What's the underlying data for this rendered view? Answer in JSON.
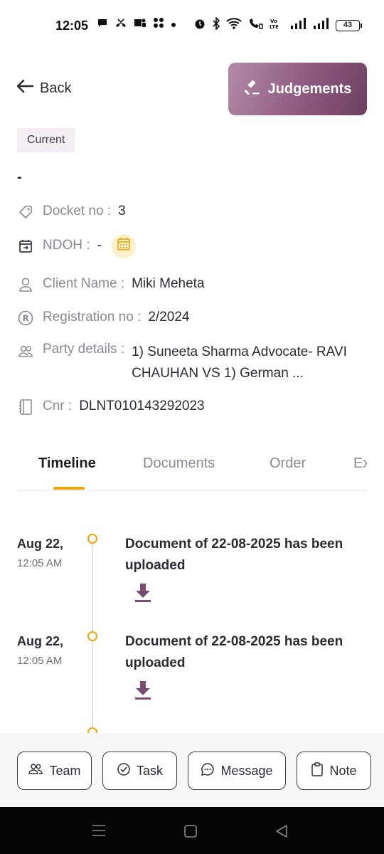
{
  "status_bar": {
    "time": "12:05",
    "battery": "43"
  },
  "header": {
    "back_label": "Back",
    "judgements_label": "Judgements"
  },
  "case": {
    "status_badge": "Current",
    "title": "-",
    "docket_label": "Docket no :",
    "docket_value": "3",
    "ndoh_label": "NDOH :",
    "ndoh_value": "-",
    "client_label": "Client Name :",
    "client_value": "Miki Meheta",
    "registration_label": "Registration no :",
    "registration_value": "2/2024",
    "party_label": "Party details :",
    "party_value": "1) Suneeta Sharma   Advocate- RAVI CHAUHAN VS 1) German ...",
    "cnr_label": "Cnr :",
    "cnr_value": "DLNT010143292023"
  },
  "tabs": [
    {
      "label": "Timeline",
      "active": true
    },
    {
      "label": "Documents",
      "active": false
    },
    {
      "label": "Order",
      "active": false
    },
    {
      "label": "Ex",
      "active": false
    }
  ],
  "timeline": [
    {
      "date": "Aug 22,",
      "time": "12:05 AM",
      "text": "Document of 22-08-2025 has been uploaded"
    },
    {
      "date": "Aug 22,",
      "time": "12:05 AM",
      "text": "Document of 22-08-2025 has been uploaded"
    }
  ],
  "actions": {
    "team": "Team",
    "task": "Task",
    "message": "Message",
    "note": "Note"
  },
  "colors": {
    "accent": "#f0a30a",
    "brand": "#8e5a80"
  }
}
